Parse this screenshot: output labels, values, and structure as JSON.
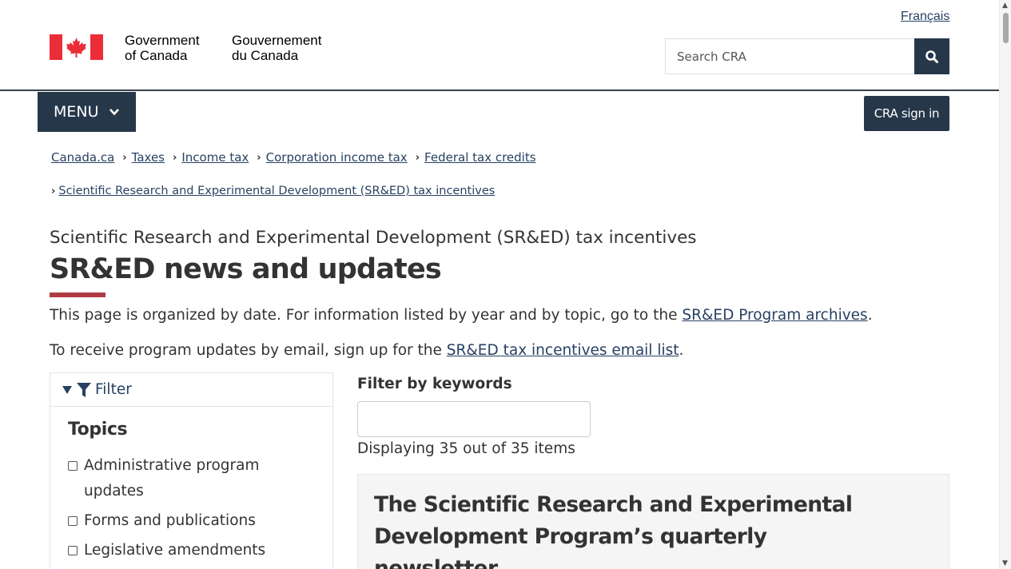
{
  "header": {
    "language_link": "Français",
    "goc_en_line1": "Government",
    "goc_en_line2": "of Canada",
    "goc_fr_line1": "Gouvernement",
    "goc_fr_line2": "du Canada",
    "search_placeholder": "Search CRA",
    "search_icon": "search-icon",
    "menu_label": "MENU",
    "signin_label": "CRA sign in"
  },
  "breadcrumbs": {
    "row1": [
      "Canada.ca",
      "Taxes",
      "Income tax",
      "Corporation income tax",
      "Federal tax credits"
    ],
    "row2": [
      "Scientific Research and Experimental Development (SR&ED) tax incentives"
    ]
  },
  "main": {
    "subtitle": "Scientific Research and Experimental Development (SR&ED) tax incentives",
    "title": "SR&ED news and updates",
    "intro1_prefix": "This page is organized by date. For information listed by year and by topic, go to the ",
    "intro1_link": "SR&ED Program archives",
    "intro1_suffix": ".",
    "intro2_prefix": "To receive program updates by email, sign up for the ",
    "intro2_link": "SR&ED tax incentives email list",
    "intro2_suffix": "."
  },
  "filter": {
    "toggle_label": "Filter",
    "topics_title": "Topics",
    "topics": [
      "Administrative program updates",
      "Forms and publications",
      "Legislative amendments"
    ],
    "keywords_label": "Filter by keywords",
    "keywords_value": "",
    "count_text": "Displaying 35 out of 35 items"
  },
  "card": {
    "title": "The Scientific Research and Experimental Development Program’s quarterly newsletter"
  },
  "colors": {
    "accent_dark": "#26374a",
    "link": "#284162",
    "title_underline": "#af3c43",
    "flag_red": "#eb2d37"
  }
}
